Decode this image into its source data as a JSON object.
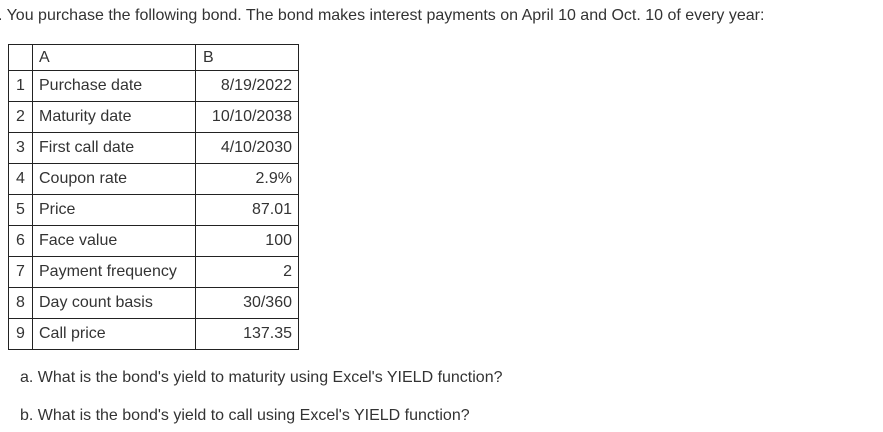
{
  "intro_text": ". You purchase the following bond. The bond makes interest payments on April 10 and Oct. 10 of every year:",
  "table": {
    "column_headers": {
      "corner": "",
      "a": "A",
      "b": "B"
    },
    "rows": [
      {
        "num": "1",
        "label": "Purchase date",
        "value": "8/19/2022"
      },
      {
        "num": "2",
        "label": "Maturity date",
        "value": "10/10/2038"
      },
      {
        "num": "3",
        "label": "First call date",
        "value": "4/10/2030"
      },
      {
        "num": "4",
        "label": "Coupon rate",
        "value": "2.9%"
      },
      {
        "num": "5",
        "label": "Price",
        "value": "87.01"
      },
      {
        "num": "6",
        "label": "Face value",
        "value": "100"
      },
      {
        "num": "7",
        "label": "Payment frequency",
        "value": "2"
      },
      {
        "num": "8",
        "label": "Day count basis",
        "value": "30/360"
      },
      {
        "num": "9",
        "label": "Call price",
        "value": "137.35"
      }
    ]
  },
  "questions": {
    "a": "a. What is the bond's yield to maturity using Excel's YIELD function?",
    "b": "b. What is the bond's yield to call using Excel's YIELD function?"
  }
}
